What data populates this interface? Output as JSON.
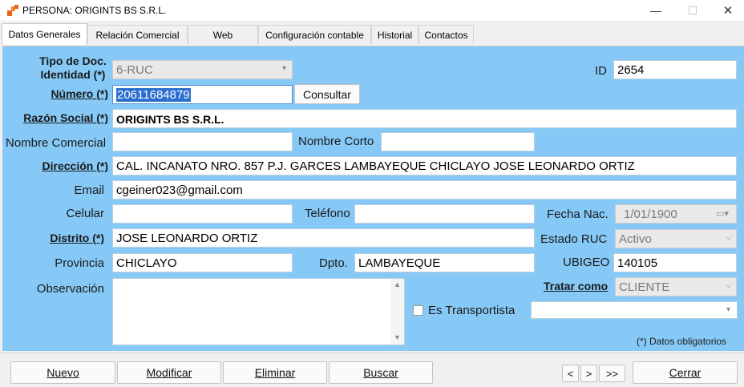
{
  "window": {
    "title": "PERSONA: ORIGINTS BS S.R.L.",
    "min": "—",
    "max": "☐",
    "close": "✕"
  },
  "tabs": [
    {
      "label": "Datos Generales"
    },
    {
      "label": "Relación Comercial"
    },
    {
      "label": "Web"
    },
    {
      "label": "Configuración contable"
    },
    {
      "label": "Historial"
    },
    {
      "label": "Contactos"
    }
  ],
  "form": {
    "tipo_doc_label_1": "Tipo de Doc.",
    "tipo_doc_label_2": "Identidad (*)",
    "tipo_doc_value": "6-RUC",
    "id_label": "ID",
    "id_value": "2654",
    "numero_label": "Número (*)",
    "numero_value": "20611684879",
    "consultar_label": "Consultar",
    "razon_label": "Razón Social (*)",
    "razon_value": "ORIGINTS BS S.R.L.",
    "nombre_comercial_label": "Nombre Comercial",
    "nombre_comercial_value": "",
    "nombre_corto_label": "Nombre Corto",
    "nombre_corto_value": "",
    "direccion_label": "Dirección (*)",
    "direccion_value": "CAL. INCANATO NRO. 857 P.J. GARCES LAMBAYEQUE CHICLAYO JOSE LEONARDO ORTIZ",
    "email_label": "Email",
    "email_value": "cgeiner023@gmail.com",
    "celular_label": "Celular",
    "celular_value": "",
    "telefono_label": "Teléfono",
    "telefono_value": "",
    "fecha_label": "Fecha Nac.",
    "fecha_value": "1/01/1900",
    "distrito_label": "Distrito (*)",
    "distrito_value": "JOSE LEONARDO ORTIZ",
    "estado_label": "Estado RUC",
    "estado_value": "Activo",
    "provincia_label": "Provincia",
    "provincia_value": "CHICLAYO",
    "dpto_label": "Dpto.",
    "dpto_value": "LAMBAYEQUE",
    "ubigeo_label": "UBIGEO",
    "ubigeo_value": "140105",
    "observacion_label": "Observación",
    "observacion_value": "",
    "tratar_label": "Tratar como",
    "tratar_value": "CLIENTE",
    "transportista_label": "Es Transportista",
    "transportista_value": "",
    "obligatorios_note": "(*) Datos obligatorios"
  },
  "buttons": {
    "nuevo": "Nuevo",
    "modificar": "Modificar",
    "eliminar": "Eliminar",
    "buscar": "Buscar",
    "prev": "<",
    "next": ">",
    "last": ">>",
    "cerrar": "Cerrar"
  },
  "colors": {
    "panel": "#86c9f7",
    "accent": "#2a6fd0"
  }
}
